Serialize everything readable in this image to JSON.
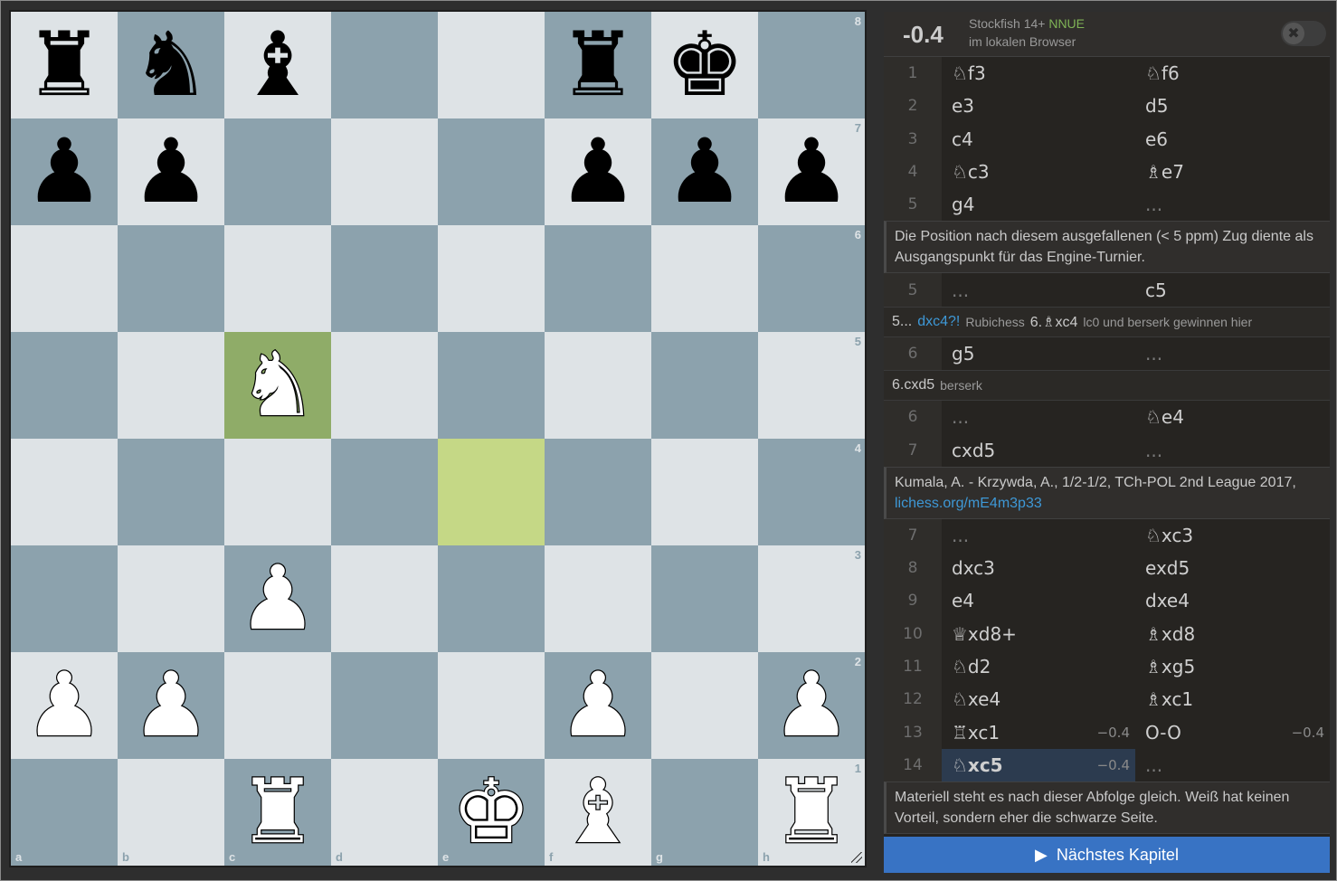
{
  "board": {
    "files": [
      "a",
      "b",
      "c",
      "d",
      "e",
      "f",
      "g",
      "h"
    ],
    "ranks": [
      "8",
      "7",
      "6",
      "5",
      "4",
      "3",
      "2",
      "1"
    ],
    "squares": [
      [
        "br",
        "bn",
        "bb",
        "",
        "",
        "br",
        "bk",
        ""
      ],
      [
        "bp",
        "bp",
        "",
        "",
        "",
        "bp",
        "bp",
        "bp"
      ],
      [
        "",
        "",
        "",
        "",
        "",
        "",
        "",
        ""
      ],
      [
        "",
        "",
        "wn",
        "",
        "",
        "",
        "",
        ""
      ],
      [
        "",
        "",
        "",
        "",
        "",
        "",
        "",
        ""
      ],
      [
        "",
        "",
        "wp",
        "",
        "",
        "",
        "",
        ""
      ],
      [
        "wp",
        "wp",
        "",
        "",
        "",
        "wp",
        "",
        "wp"
      ],
      [
        "",
        "",
        "wr",
        "",
        "wk",
        "wb",
        "",
        "wr"
      ]
    ],
    "last_move": {
      "from": "e4",
      "to": "c5"
    }
  },
  "ceval": {
    "score": "-0.4",
    "engine_name": "Stockfish 14+",
    "engine_tag": "NNUE",
    "engine_sub": "im lokalen Browser",
    "toggle_icon": "✖"
  },
  "moves_block1": [
    {
      "num": "1",
      "white": "♘f3",
      "black": "♘f6"
    },
    {
      "num": "2",
      "white": "e3",
      "black": "d5"
    },
    {
      "num": "3",
      "white": "c4",
      "black": "e6"
    },
    {
      "num": "4",
      "white": "♘c3",
      "black": "♗e7"
    },
    {
      "num": "5",
      "white": "g4",
      "black": "..."
    }
  ],
  "comment1": "Die Position nach diesem ausgefallenen (< 5 ppm) Zug diente als Ausgangspunkt für das Engine-Turnier.",
  "moves_block2": [
    {
      "num": "5",
      "white": "...",
      "black": "c5"
    }
  ],
  "variation1": {
    "prefix": "5...",
    "move": "dxc4?!",
    "engine": "Rubichess",
    "move2": "6.♗xc4",
    "note": "lc0 und berserk gewinnen hier"
  },
  "moves_block3": [
    {
      "num": "6",
      "white": "g5",
      "black": "..."
    }
  ],
  "variation2": {
    "move": "6.cxd5",
    "engine": "berserk"
  },
  "moves_block4": [
    {
      "num": "6",
      "white": "...",
      "black": "♘e4"
    },
    {
      "num": "7",
      "white": "cxd5",
      "black": "..."
    }
  ],
  "comment2": {
    "text": "Kumala, A. - Krzywda, A., 1/2-1/2, TCh-POL 2nd League 2017,",
    "link": "lichess.org/mE4m3p33"
  },
  "moves_block5": [
    {
      "num": "7",
      "white": "...",
      "black": "♘xc3"
    },
    {
      "num": "8",
      "white": "dxc3",
      "black": "exd5"
    },
    {
      "num": "9",
      "white": "e4",
      "black": "dxe4"
    },
    {
      "num": "10",
      "white": "♕xd8+",
      "black": "♗xd8"
    },
    {
      "num": "11",
      "white": "♘d2",
      "black": "♗xg5"
    },
    {
      "num": "12",
      "white": "♘xe4",
      "black": "♗xc1"
    },
    {
      "num": "13",
      "white": "♖xc1",
      "white_eval": "−0.4",
      "black": "O-O",
      "black_eval": "−0.4"
    },
    {
      "num": "14",
      "white": "♘xc5",
      "white_eval": "−0.4",
      "black": "...",
      "active": true
    }
  ],
  "comment3": "Materiell steht es nach dieser Abfolge gleich. Weiß hat keinen Vorteil, sondern eher die schwarze Seite.",
  "next_button": {
    "label": "Nächstes Kapitel",
    "icon": "▶"
  }
}
